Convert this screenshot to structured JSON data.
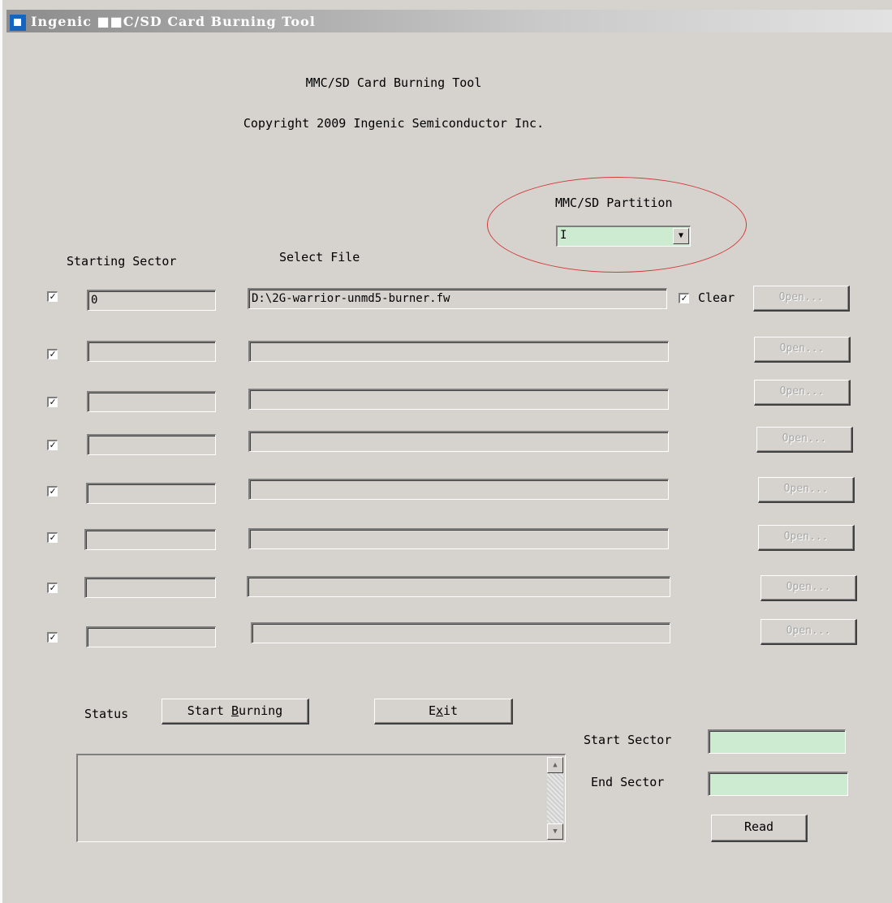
{
  "window": {
    "title": "Ingenic ■■C/SD Card Burning Tool"
  },
  "header": {
    "title": "MMC/SD Card Burning Tool",
    "copyright": "Copyright 2009 Ingenic Semiconductor Inc."
  },
  "partition": {
    "label": "MMC/SD Partition",
    "value": "I"
  },
  "columns": {
    "starting_sector": "Starting Sector",
    "select_file": "Select File"
  },
  "rows": [
    {
      "checked": true,
      "sector": "0",
      "file": "D:\\2G-warrior-unmd5-burner.fw",
      "open_label": "Open..."
    },
    {
      "checked": true,
      "sector": "",
      "file": "",
      "open_label": "Open..."
    },
    {
      "checked": true,
      "sector": "",
      "file": "",
      "open_label": "Open..."
    },
    {
      "checked": true,
      "sector": "",
      "file": "",
      "open_label": "Open..."
    },
    {
      "checked": true,
      "sector": "",
      "file": "",
      "open_label": "Open..."
    },
    {
      "checked": true,
      "sector": "",
      "file": "",
      "open_label": "Open..."
    },
    {
      "checked": true,
      "sector": "",
      "file": "",
      "open_label": "Open..."
    },
    {
      "checked": true,
      "sector": "",
      "file": "",
      "open_label": "Open..."
    }
  ],
  "clear": {
    "checked": true,
    "label": "Clear"
  },
  "status": {
    "label": "Status",
    "text": ""
  },
  "buttons": {
    "start_prefix": "Start ",
    "start_key": "B",
    "start_rest": "urning",
    "exit_prefix": "E",
    "exit_key": "x",
    "exit_rest": "it",
    "read": "Read"
  },
  "read_range": {
    "start_label": "Start Sector",
    "start_value": "",
    "end_label": "End Sector",
    "end_value": ""
  },
  "colors": {
    "face": "#d6d3ce",
    "input_green": "#cdebd0",
    "annotation": "#d23a3a"
  }
}
